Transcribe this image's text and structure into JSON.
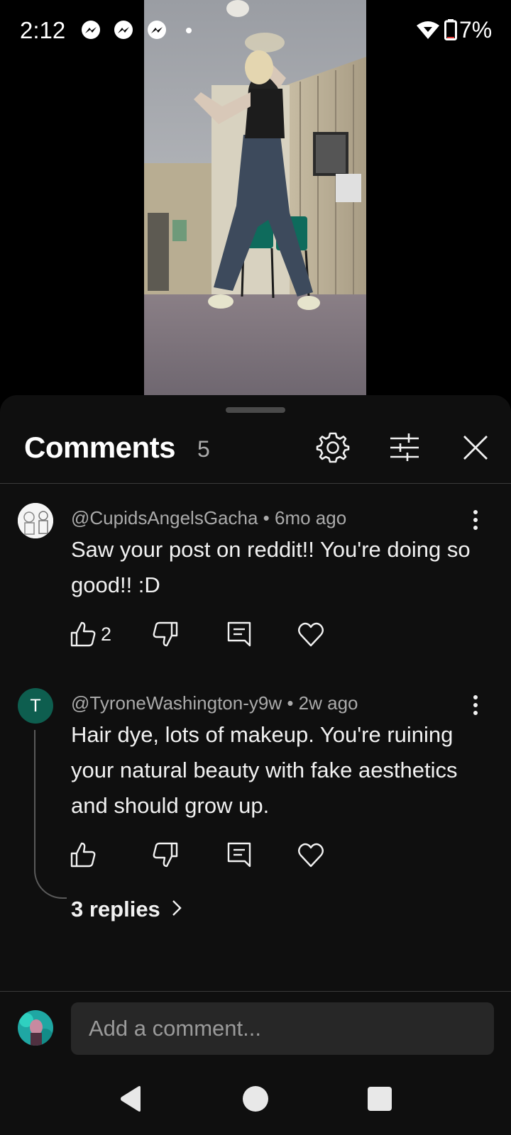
{
  "status_bar": {
    "time": "2:12",
    "battery_text": "7%",
    "notification_icons": [
      "messenger-icon",
      "messenger-icon",
      "messenger-icon",
      "dot-icon"
    ]
  },
  "comments_panel": {
    "title": "Comments",
    "count": "5",
    "header_icons": [
      "gear-icon",
      "filter-sliders-icon",
      "close-icon"
    ]
  },
  "comments": [
    {
      "author": "@CupidsAngelsGacha",
      "age": "6mo ago",
      "meta": "@CupidsAngelsGacha • 6mo ago",
      "text": "Saw your post on reddit!! You're doing so good!! :D",
      "likes": "2"
    },
    {
      "avatar_letter": "T",
      "author": "@TyroneWashington-y9w",
      "age": "2w ago",
      "meta": "@TyroneWashington-y9w • 2w ago",
      "text": "Hair dye, lots of makeup. You're ruining your natural beauty with fake aesthetics and should grow up.",
      "likes": "",
      "replies_label": "3 replies"
    }
  ],
  "composer": {
    "placeholder": "Add a comment..."
  },
  "colors": {
    "sheet_bg": "#0f0f0f",
    "input_bg": "#272727",
    "avatar_t_bg": "#0e5e4f",
    "muted_text": "#aaaaaa"
  }
}
